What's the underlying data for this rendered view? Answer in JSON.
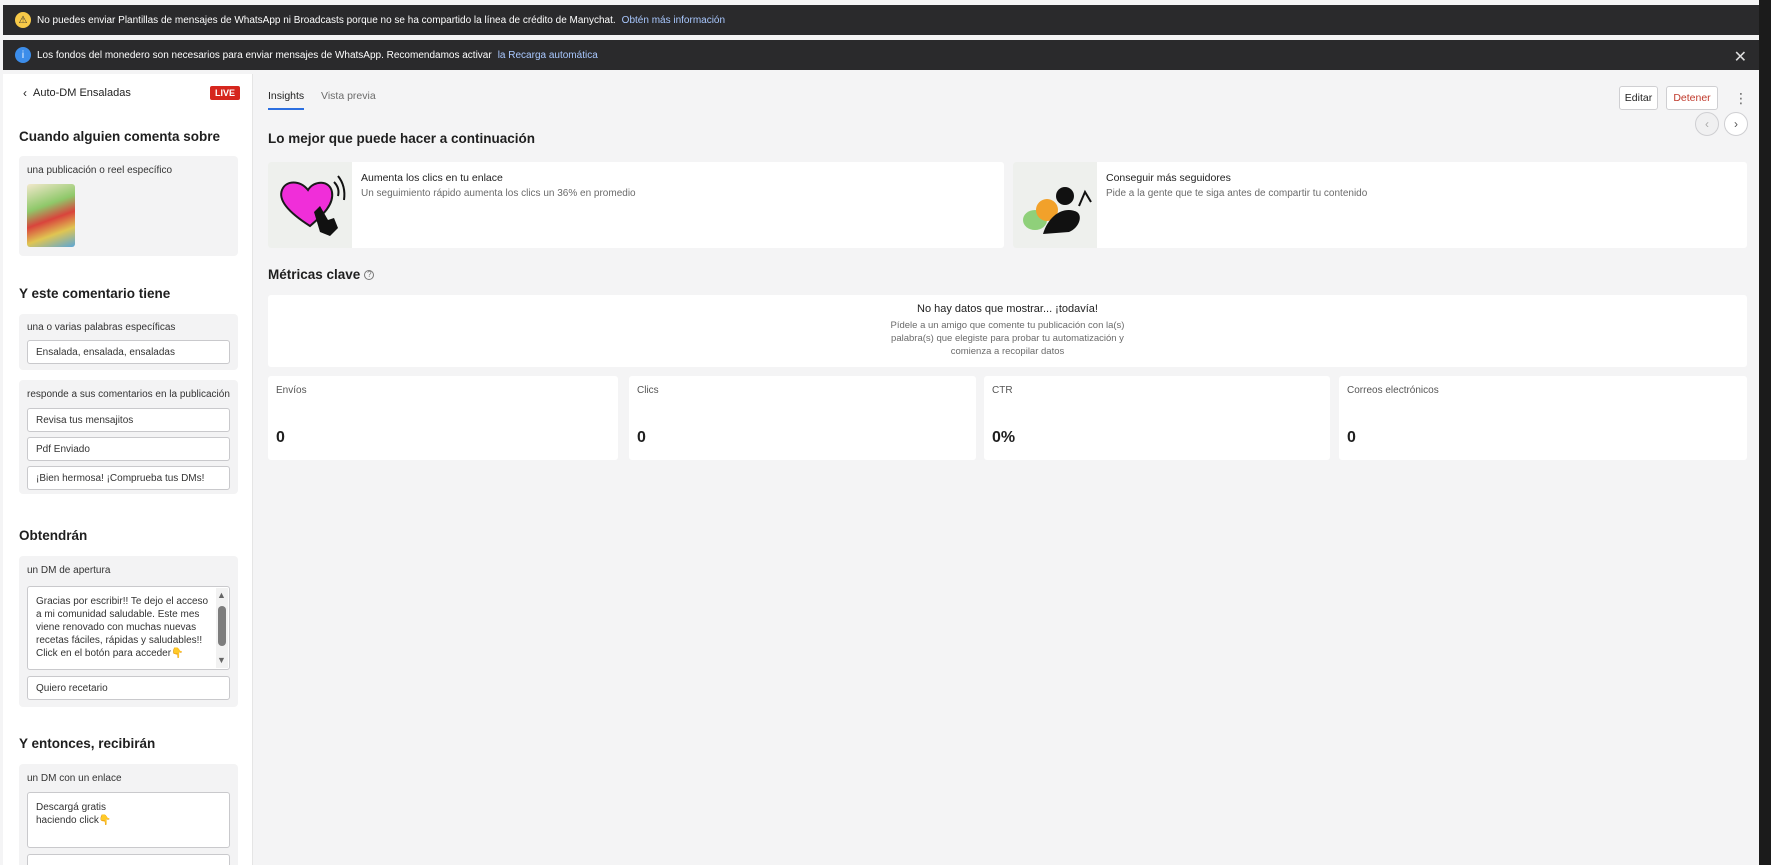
{
  "banners": {
    "whatsapp": {
      "text": "No puedes enviar Plantillas de mensajes de WhatsApp ni Broadcasts porque no se ha compartido la línea de crédito de Manychat.",
      "link": "Obtén más información"
    },
    "wallet": {
      "text": "Los fondos del monedero son necesarios para enviar mensajes de WhatsApp. Recomendamos activar",
      "link": "la Recarga automática"
    }
  },
  "sidebar": {
    "back_label": "Auto-DM Ensaladas",
    "live_badge": "LIVE",
    "trigger": {
      "title": "Cuando alguien comenta sobre",
      "label": "una publicación o reel específico"
    },
    "keywords": {
      "title": "Y este comentario tiene",
      "label": "una o varias palabras específicas",
      "value": "Ensalada, ensalada, ensaladas"
    },
    "replies": {
      "label": "responde a sus comentarios en la publicación",
      "items": [
        "Revisa tus mensajitos",
        "Pdf Enviado",
        "¡Bien hermosa! ¡Comprueba tus DMs!"
      ]
    },
    "opening": {
      "title": "Obtendrán",
      "label": "un DM de apertura",
      "message": "Gracias por escribir!! Te dejo el acceso a mi comunidad saludable. Este mes viene renovado con muchas nuevas recetas fáciles, rápidas y saludables!! Click en el botón para acceder👇",
      "button": "Quiero recetario"
    },
    "link_dm": {
      "title": "Y entonces, recibirán",
      "label": "un DM con un enlace",
      "message": "Descargá gratis haciendo click👇"
    }
  },
  "main": {
    "tabs": [
      "Insights",
      "Vista previa"
    ],
    "buttons": {
      "edit": "Editar",
      "stop": "Detener"
    },
    "next_title": "Lo mejor que puede hacer a continuación",
    "suggestions": [
      {
        "title": "Aumenta los clics en tu enlace",
        "desc": "Un seguimiento rápido aumenta los clics un 36% en promedio"
      },
      {
        "title": "Conseguir más seguidores",
        "desc": "Pide a la gente que te siga antes de compartir tu contenido"
      }
    ],
    "metrics_title": "Métricas clave",
    "empty": {
      "title": "No hay datos que mostrar... ¡todavía!",
      "desc": "Pídele a un amigo que comente tu publicación con la(s) palabra(s) que elegiste para probar tu automatización y comienza a recopilar datos"
    },
    "metrics": [
      {
        "label": "Envíos",
        "value": "0"
      },
      {
        "label": "Clics",
        "value": "0"
      },
      {
        "label": "CTR",
        "value": "0%"
      },
      {
        "label": "Correos electrónicos",
        "value": "0"
      }
    ]
  }
}
